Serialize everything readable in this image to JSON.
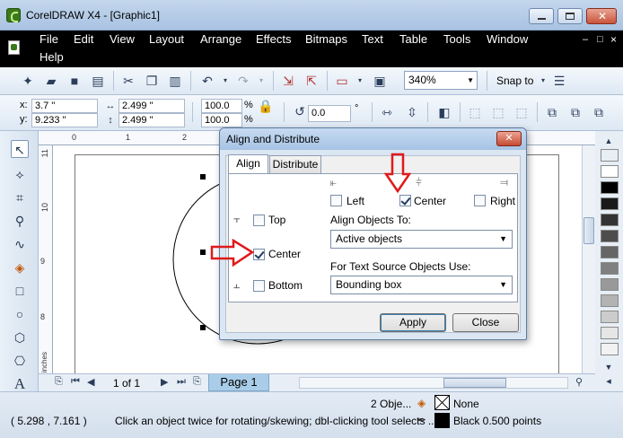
{
  "window": {
    "title": "CorelDRAW X4 - [Graphic1]",
    "min": "—",
    "max": "▢",
    "close": "✕"
  },
  "menu": [
    {
      "label": "File"
    },
    {
      "label": "Edit"
    },
    {
      "label": "View"
    },
    {
      "label": "Layout"
    },
    {
      "label": "Arrange"
    },
    {
      "label": "Effects"
    },
    {
      "label": "Bitmaps"
    },
    {
      "label": "Text"
    },
    {
      "label": "Table"
    },
    {
      "label": "Tools"
    },
    {
      "label": "Window"
    },
    {
      "label": "Help"
    }
  ],
  "mdi_controls": {
    "min": "–",
    "max": "□",
    "close": "×"
  },
  "standard_toolbar": {
    "zoom": "340%",
    "snap_to": "Snap to"
  },
  "property_bar": {
    "x_label": "x:",
    "x_value": "3.7 \"",
    "y_label": "y:",
    "y_value": "9.233 \"",
    "width_value": "2.499 \"",
    "height_value": "2.499 \"",
    "scale_x": "100.0",
    "scale_y": "100.0",
    "percent": "%",
    "rotation": "0.0",
    "degree": "°"
  },
  "rulers": {
    "unit_top": "inches",
    "unit_left": "inches",
    "top_ticks": [
      "0",
      "1",
      "2"
    ],
    "left_ticks": [
      "11",
      "10",
      "9",
      "8"
    ]
  },
  "palette_colors": [
    "#ffffff",
    "#000000",
    "#1a1a1a",
    "#333333",
    "#4d4d4d",
    "#666666",
    "#808080",
    "#999999",
    "#b3b3b3",
    "#cccccc",
    "#e6e6e6",
    "#f2f2f2"
  ],
  "page_nav": {
    "count": "1 of 1",
    "page_tab": "Page 1"
  },
  "status": {
    "objects": "2 Obje...",
    "fill": "None",
    "coords": "( 5.298 , 7.161 )",
    "hint": "Click an object twice for rotating/skewing; dbl-clicking tool selects ...",
    "outline": "Black  0.500 points"
  },
  "dialog": {
    "title": "Align and Distribute",
    "close": "✕",
    "tabs": [
      {
        "label": "Align"
      },
      {
        "label": "Distribute"
      }
    ],
    "horizontal": [
      {
        "label": "Left",
        "checked": false
      },
      {
        "label": "Center",
        "checked": true
      },
      {
        "label": "Right",
        "checked": false
      }
    ],
    "vertical": [
      {
        "label": "Top",
        "checked": false
      },
      {
        "label": "Center",
        "checked": true
      },
      {
        "label": "Bottom",
        "checked": false
      }
    ],
    "align_to_label": "Align Objects To:",
    "align_to_value": "Active objects",
    "text_source_label": "For Text Source Objects Use:",
    "text_source_value": "Bounding box",
    "apply": "Apply",
    "close_button": "Close"
  },
  "colors": {
    "annotation_arrow": "#e0191b",
    "page_tab": "#a9cde9"
  }
}
